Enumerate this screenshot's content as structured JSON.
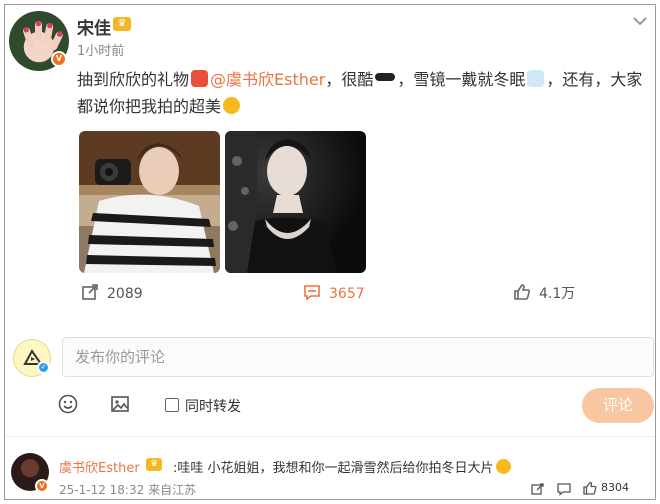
{
  "post": {
    "author": "宋佳",
    "verified_badge": "V",
    "time": "1小时前",
    "text_part1": "抽到欣欣的礼物",
    "mention": "@虞书欣Esther",
    "text_part2": "，很酷",
    "text_part3": "，雪镜一戴就冬眠",
    "text_part4": "，还有，大家都说你把我拍的超美",
    "images": [
      {
        "alt": "girl-with-camera-striped-sweater"
      },
      {
        "alt": "woman-black-dress"
      }
    ]
  },
  "stats": {
    "reposts": "2089",
    "comments": "3657",
    "likes": "4.1万"
  },
  "composer": {
    "placeholder": "发布你的评论",
    "repost_label": "同时转发",
    "submit_label": "评论"
  },
  "comment": {
    "author": "虞书欣Esther",
    "text": ":哇哇 小花姐姐，我想和你一起滑雪然后给你拍冬日大片",
    "date": "25-1-12 18:32",
    "location": "来自江苏",
    "likes": "8304"
  },
  "colors": {
    "accent": "#eb7340",
    "submit_bg": "#f8c7a2",
    "verified": "#f26d1d",
    "crown": "#f5b623"
  },
  "icons": [
    "crown-icon",
    "chevron-down-icon",
    "gift-icon",
    "sunglasses-icon",
    "sleep-icon",
    "surprised-emoji-icon",
    "repost-icon",
    "comment-icon",
    "like-icon",
    "emoji-icon",
    "image-icon",
    "grin-emoji-icon"
  ]
}
